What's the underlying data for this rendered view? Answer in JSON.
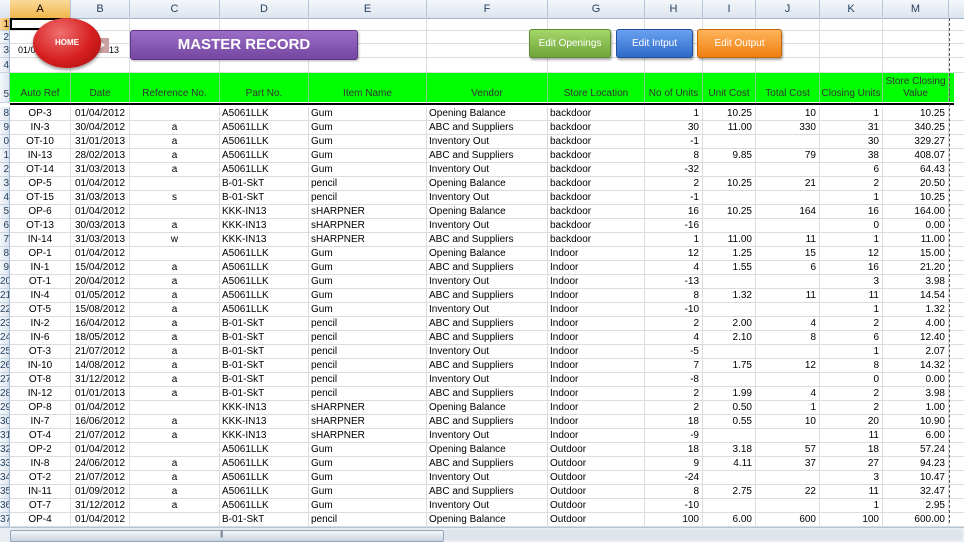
{
  "sheet": {
    "columns": [
      "A",
      "B",
      "C",
      "D",
      "E",
      "F",
      "G",
      "H",
      "I",
      "J",
      "K",
      "M"
    ],
    "selected_column": "A",
    "top_row_numbers": [
      "1",
      "2",
      "3",
      "4",
      "5"
    ],
    "selected_row": "1",
    "cell_a3_fragment": "01/0",
    "cell_b3_fragment": "13"
  },
  "buttons": {
    "home": "HOME",
    "title": "MASTER RECORD",
    "edit_openings": "Edit Openings",
    "edit_input": "Edit Intput",
    "edit_output": "Edit Output"
  },
  "headers": [
    "Auto Ref",
    "Date",
    "Reference No.",
    "Part No.",
    "Item Name",
    "Vendor",
    "Store Location",
    "No of Units",
    "Unit Cost",
    "Total Cost",
    "Closing Units",
    "Store Closing Value"
  ],
  "colors": {
    "header_green": "#00ff00",
    "title_purple": "#7f55ac",
    "home_red": "#d61f1f",
    "btn_green": "#7fb646",
    "btn_blue": "#3a77d6",
    "btn_orange": "#f28a1e"
  },
  "rows": [
    {
      "num": "8",
      "cells": [
        "OP-3",
        "01/04/2012",
        "",
        "A5061LLK",
        "Gum",
        "Opening Balance",
        "backdoor",
        "1",
        "10.25",
        "10",
        "1",
        "10.25"
      ]
    },
    {
      "num": "9",
      "cells": [
        "IN-3",
        "30/04/2012",
        "a",
        "A5061LLK",
        "Gum",
        "ABC and Suppliers",
        "backdoor",
        "30",
        "11.00",
        "330",
        "31",
        "340.25"
      ]
    },
    {
      "num": "0",
      "cells": [
        "OT-10",
        "31/01/2013",
        "a",
        "A5061LLK",
        "Gum",
        "Inventory Out",
        "backdoor",
        "-1",
        "",
        "",
        "30",
        "329.27"
      ]
    },
    {
      "num": "1",
      "cells": [
        "IN-13",
        "28/02/2013",
        "a",
        "A5061LLK",
        "Gum",
        "ABC and Suppliers",
        "backdoor",
        "8",
        "9.85",
        "79",
        "38",
        "408.07"
      ]
    },
    {
      "num": "2",
      "cells": [
        "OT-14",
        "31/03/2013",
        "a",
        "A5061LLK",
        "Gum",
        "Inventory Out",
        "backdoor",
        "-32",
        "",
        "",
        "6",
        "64.43"
      ]
    },
    {
      "num": "3",
      "cells": [
        "OP-5",
        "01/04/2012",
        "",
        "B-01-SkT",
        "pencil",
        "Opening Balance",
        "backdoor",
        "2",
        "10.25",
        "21",
        "2",
        "20.50"
      ]
    },
    {
      "num": "4",
      "cells": [
        "OT-15",
        "31/03/2013",
        "s",
        "B-01-SkT",
        "pencil",
        "Inventory Out",
        "backdoor",
        "-1",
        "",
        "",
        "1",
        "10.25"
      ]
    },
    {
      "num": "5",
      "cells": [
        "OP-6",
        "01/04/2012",
        "",
        "KKK-IN13",
        "sHARPNER",
        "Opening Balance",
        "backdoor",
        "16",
        "10.25",
        "164",
        "16",
        "164.00"
      ]
    },
    {
      "num": "6",
      "cells": [
        "OT-13",
        "30/03/2013",
        "a",
        "KKK-IN13",
        "sHARPNER",
        "Inventory Out",
        "backdoor",
        "-16",
        "",
        "",
        "0",
        "0.00"
      ]
    },
    {
      "num": "7",
      "cells": [
        "IN-14",
        "31/03/2013",
        "w",
        "KKK-IN13",
        "sHARPNER",
        "ABC and Suppliers",
        "backdoor",
        "1",
        "11.00",
        "11",
        "1",
        "11.00"
      ]
    },
    {
      "num": "8",
      "cells": [
        "OP-1",
        "01/04/2012",
        "",
        "A5061LLK",
        "Gum",
        "Opening Balance",
        "Indoor",
        "12",
        "1.25",
        "15",
        "12",
        "15.00"
      ]
    },
    {
      "num": "9",
      "cells": [
        "IN-1",
        "15/04/2012",
        "a",
        "A5061LLK",
        "Gum",
        "ABC and Suppliers",
        "Indoor",
        "4",
        "1.55",
        "6",
        "16",
        "21.20"
      ]
    },
    {
      "num": "20",
      "cells": [
        "OT-1",
        "20/04/2012",
        "a",
        "A5061LLK",
        "Gum",
        "Inventory Out",
        "Indoor",
        "-13",
        "",
        "",
        "3",
        "3.98"
      ]
    },
    {
      "num": "21",
      "cells": [
        "IN-4",
        "01/05/2012",
        "a",
        "A5061LLK",
        "Gum",
        "ABC and Suppliers",
        "Indoor",
        "8",
        "1.32",
        "11",
        "11",
        "14.54"
      ]
    },
    {
      "num": "22",
      "cells": [
        "OT-5",
        "15/08/2012",
        "a",
        "A5061LLK",
        "Gum",
        "Inventory Out",
        "Indoor",
        "-10",
        "",
        "",
        "1",
        "1.32"
      ]
    },
    {
      "num": "23",
      "cells": [
        "IN-2",
        "16/04/2012",
        "a",
        "B-01-SkT",
        "pencil",
        "ABC and Suppliers",
        "Indoor",
        "2",
        "2.00",
        "4",
        "2",
        "4.00"
      ]
    },
    {
      "num": "24",
      "cells": [
        "IN-6",
        "18/05/2012",
        "a",
        "B-01-SkT",
        "pencil",
        "ABC and Suppliers",
        "Indoor",
        "4",
        "2.10",
        "8",
        "6",
        "12.40"
      ]
    },
    {
      "num": "25",
      "cells": [
        "OT-3",
        "21/07/2012",
        "a",
        "B-01-SkT",
        "pencil",
        "Inventory Out",
        "Indoor",
        "-5",
        "",
        "",
        "1",
        "2.07"
      ]
    },
    {
      "num": "26",
      "cells": [
        "IN-10",
        "14/08/2012",
        "a",
        "B-01-SkT",
        "pencil",
        "ABC and Suppliers",
        "Indoor",
        "7",
        "1.75",
        "12",
        "8",
        "14.32"
      ]
    },
    {
      "num": "27",
      "cells": [
        "OT-8",
        "31/12/2012",
        "a",
        "B-01-SkT",
        "pencil",
        "Inventory Out",
        "Indoor",
        "-8",
        "",
        "",
        "0",
        "0.00"
      ]
    },
    {
      "num": "28",
      "cells": [
        "IN-12",
        "01/01/2013",
        "a",
        "B-01-SkT",
        "pencil",
        "ABC and Suppliers",
        "Indoor",
        "2",
        "1.99",
        "4",
        "2",
        "3.98"
      ]
    },
    {
      "num": "29",
      "cells": [
        "OP-8",
        "01/04/2012",
        "",
        "KKK-IN13",
        "sHARPNER",
        "Opening Balance",
        "Indoor",
        "2",
        "0.50",
        "1",
        "2",
        "1.00"
      ]
    },
    {
      "num": "30",
      "cells": [
        "IN-7",
        "16/06/2012",
        "a",
        "KKK-IN13",
        "sHARPNER",
        "ABC and Suppliers",
        "Indoor",
        "18",
        "0.55",
        "10",
        "20",
        "10.90"
      ]
    },
    {
      "num": "31",
      "cells": [
        "OT-4",
        "21/07/2012",
        "a",
        "KKK-IN13",
        "sHARPNER",
        "Inventory Out",
        "Indoor",
        "-9",
        "",
        "",
        "11",
        "6.00"
      ]
    },
    {
      "num": "32",
      "cells": [
        "OP-2",
        "01/04/2012",
        "",
        "A5061LLK",
        "Gum",
        "Opening Balance",
        "Outdoor",
        "18",
        "3.18",
        "57",
        "18",
        "57.24"
      ]
    },
    {
      "num": "33",
      "cells": [
        "IN-8",
        "24/06/2012",
        "a",
        "A5061LLK",
        "Gum",
        "ABC and Suppliers",
        "Outdoor",
        "9",
        "4.11",
        "37",
        "27",
        "94.23"
      ]
    },
    {
      "num": "34",
      "cells": [
        "OT-2",
        "21/07/2012",
        "a",
        "A5061LLK",
        "Gum",
        "Inventory Out",
        "Outdoor",
        "-24",
        "",
        "",
        "3",
        "10.47"
      ]
    },
    {
      "num": "35",
      "cells": [
        "IN-11",
        "01/09/2012",
        "a",
        "A5061LLK",
        "Gum",
        "ABC and Suppliers",
        "Outdoor",
        "8",
        "2.75",
        "22",
        "11",
        "32.47"
      ]
    },
    {
      "num": "36",
      "cells": [
        "OT-7",
        "31/12/2012",
        "a",
        "A5061LLK",
        "Gum",
        "Inventory Out",
        "Outdoor",
        "-10",
        "",
        "",
        "1",
        "2.95"
      ]
    },
    {
      "num": "37",
      "cells": [
        "OP-4",
        "01/04/2012",
        "",
        "B-01-SkT",
        "pencil",
        "Opening Balance",
        "Outdoor",
        "100",
        "6.00",
        "600",
        "100",
        "600.00"
      ]
    }
  ]
}
